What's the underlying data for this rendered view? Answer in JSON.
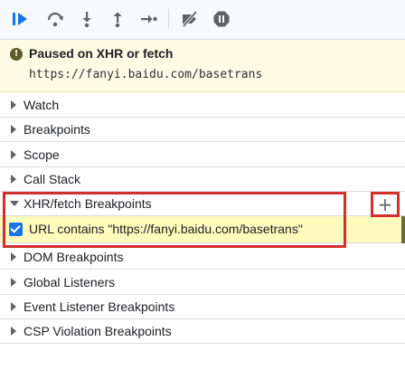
{
  "toolbar": {
    "buttons": [
      {
        "icon": "resume-icon"
      },
      {
        "icon": "step-over-icon"
      },
      {
        "icon": "step-into-icon"
      },
      {
        "icon": "step-out-icon"
      },
      {
        "icon": "step-icon"
      },
      {
        "icon": "deactivate-breakpoints-icon"
      },
      {
        "icon": "pause-on-exceptions-icon"
      }
    ],
    "accent_color": "#1a73e8"
  },
  "paused": {
    "icon": "info-icon",
    "title": "Paused on XHR or fetch",
    "url": "https://fanyi.baidu.com/basetrans"
  },
  "sections": [
    {
      "label": "Watch",
      "expanded": false
    },
    {
      "label": "Breakpoints",
      "expanded": false
    },
    {
      "label": "Scope",
      "expanded": false
    },
    {
      "label": "Call Stack",
      "expanded": false
    },
    {
      "label": "XHR/fetch Breakpoints",
      "expanded": true
    },
    {
      "label": "DOM Breakpoints",
      "expanded": false
    },
    {
      "label": "Global Listeners",
      "expanded": false
    },
    {
      "label": "Event Listener Breakpoints",
      "expanded": false
    },
    {
      "label": "CSP Violation Breakpoints",
      "expanded": false
    }
  ],
  "xhr_breakpoint": {
    "checked": true,
    "text": "URL contains \"https://fanyi.baidu.com/basetrans\""
  },
  "add_button": {
    "label": "+"
  },
  "colors": {
    "annotation": "#d32f2f",
    "paused_bg": "#fffbe5",
    "highlight_bg": "#fffbbd"
  }
}
